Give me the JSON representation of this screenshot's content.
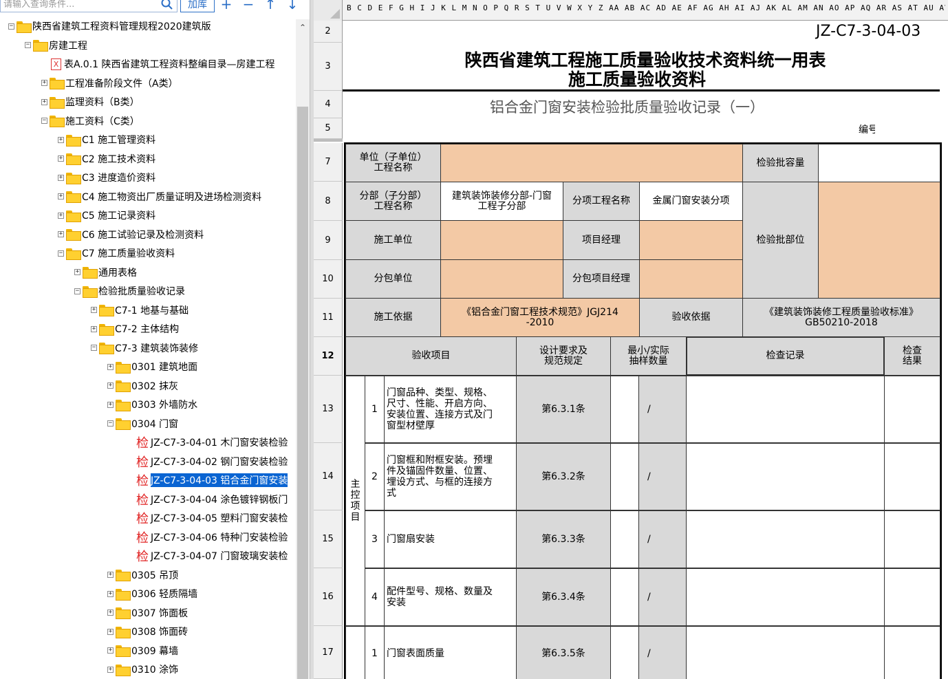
{
  "search": {
    "placeholder": "请输入查询条件...",
    "add_lib_label": "加库"
  },
  "toolbar": {
    "plus": "+",
    "minus": "−",
    "up": "↑",
    "down": "↓"
  },
  "tree": [
    {
      "label": "陕西省建筑工程资料管理规程2020建筑版",
      "icon": "folder",
      "expander": "−"
    },
    {
      "label": "房建工程",
      "icon": "folder",
      "expander": "−"
    },
    {
      "label": "表A.0.1 陕西省建筑工程资料整编目录—房建工程",
      "icon": "xls",
      "expander": ""
    },
    {
      "label": "工程准备阶段文件（A类）",
      "icon": "folder",
      "expander": "+"
    },
    {
      "label": "监理资料（B类）",
      "icon": "folder",
      "expander": "+"
    },
    {
      "label": "施工资料（C类）",
      "icon": "folder",
      "expander": "−"
    },
    {
      "label": "C1 施工管理资料",
      "icon": "folder",
      "expander": "+"
    },
    {
      "label": "C2 施工技术资料",
      "icon": "folder",
      "expander": "+"
    },
    {
      "label": "C3 进度造价资料",
      "icon": "folder",
      "expander": "+"
    },
    {
      "label": "C4 施工物资出厂质量证明及进场检测资料",
      "icon": "folder",
      "expander": "+"
    },
    {
      "label": "C5 施工记录资料",
      "icon": "folder",
      "expander": "+"
    },
    {
      "label": "C6 施工试验记录及检测资料",
      "icon": "folder",
      "expander": "+"
    },
    {
      "label": "C7 施工质量验收资料",
      "icon": "folder",
      "expander": "−"
    },
    {
      "label": "通用表格",
      "icon": "folder",
      "expander": "+"
    },
    {
      "label": "检验批质量验收记录",
      "icon": "folder",
      "expander": "−"
    },
    {
      "label": "C7-1  地基与基础",
      "icon": "folder",
      "expander": "+"
    },
    {
      "label": "C7-2  主体结构",
      "icon": "folder",
      "expander": "+"
    },
    {
      "label": "C7-3  建筑装饰装修",
      "icon": "folder",
      "expander": "−"
    },
    {
      "label": "0301  建筑地面",
      "icon": "folder",
      "expander": "+"
    },
    {
      "label": "0302  抹灰",
      "icon": "folder",
      "expander": "+"
    },
    {
      "label": "0303  外墙防水",
      "icon": "folder",
      "expander": "+"
    },
    {
      "label": "0304  门窗",
      "icon": "folder",
      "expander": "−"
    },
    {
      "label": "JZ-C7-3-04-01  木门窗安装检验",
      "icon": "check",
      "expander": ""
    },
    {
      "label": "JZ-C7-3-04-02  钢门窗安装检验",
      "icon": "check",
      "expander": ""
    },
    {
      "label": "JZ-C7-3-04-03  铝合金门窗安装",
      "icon": "check",
      "expander": "",
      "selected": true
    },
    {
      "label": "JZ-C7-3-04-04  涂色镀锌钢板门",
      "icon": "check",
      "expander": ""
    },
    {
      "label": "JZ-C7-3-04-05  塑料门窗安装检",
      "icon": "check",
      "expander": ""
    },
    {
      "label": "JZ-C7-3-04-06  特种门安装检验",
      "icon": "check",
      "expander": ""
    },
    {
      "label": "JZ-C7-3-04-07  门窗玻璃安装检",
      "icon": "check",
      "expander": ""
    },
    {
      "label": "0305  吊顶",
      "icon": "folder",
      "expander": "+"
    },
    {
      "label": "0306  轻质隔墙",
      "icon": "folder",
      "expander": "+"
    },
    {
      "label": "0307  饰面板",
      "icon": "folder",
      "expander": "+"
    },
    {
      "label": "0308  饰面砖",
      "icon": "folder",
      "expander": "+"
    },
    {
      "label": "0309  幕墙",
      "icon": "folder",
      "expander": "+"
    },
    {
      "label": "0310  涂饰",
      "icon": "folder",
      "expander": "+"
    }
  ],
  "tree_check_glyph": "检",
  "sheet": {
    "column_letters": "B C D E F G H I J K L M N O P Q R S T U V W X Y Z AA AB AC AD AE AF AG AH AI AJ AK AL AM AN AO AP AQ AR AS AT AU AV AW AX AY AZ BA BB BC BD BE BF BG",
    "row_numbers": [
      "2",
      "3",
      "4",
      "5",
      "7",
      "8",
      "9",
      "10",
      "11",
      "12",
      "13",
      "14",
      "15",
      "16",
      "17"
    ],
    "code": "JZ-C7-3-04-03",
    "title1": "陕西省建筑工程施工质量验收技术资料统一用表",
    "title2": "施工质量验收资料",
    "subtitle": "铝合金门窗安装检验批质量验收记录（一）",
    "number_label": "编号:",
    "unit_label": "单位（子单位）\n工程名称",
    "capacity_label": "检验批容量",
    "division_label": "分部（子分部）\n工程名称",
    "division_value": "建筑装饰装修分部-门窗\n工程子分部",
    "subitem_label": "分项工程名称",
    "subitem_value": "金属门窗安装分项",
    "location_label": "检验批部位",
    "constructor_label": "施工单位",
    "pm_label": "项目经理",
    "subcontractor_label": "分包单位",
    "sub_pm_label": "分包项目经理",
    "basis_label": "施工依据",
    "basis_value": "《铝合金门窗工程技术规范》JGJ214\n-2010",
    "acceptance_basis_label": "验收依据",
    "acceptance_basis_value": "《建筑装饰装修工程质量验收标准》\nGB50210-2018",
    "hdr_item": "验收项目",
    "hdr_design": "设计要求及\n规范规定",
    "hdr_sample": "最小/实际\n抽样数量",
    "hdr_record": "检查记录",
    "hdr_result": "检查\n结果",
    "main_control": "主\n控\n项\n目",
    "rows": [
      {
        "no": "1",
        "item": "门窗品种、类型、规格、\n尺寸、性能、开启方向、\n安装位置、连接方式及门\n窗型材壁厚",
        "clause": "第6.3.1条",
        "slash": "/"
      },
      {
        "no": "2",
        "item": "门窗框和附框安装。预埋\n件及锚固件数量、位置、\n埋设方式、与框的连接方\n式",
        "clause": "第6.3.2条",
        "slash": "/"
      },
      {
        "no": "3",
        "item": "门窗扇安装",
        "clause": "第6.3.3条",
        "slash": "/"
      },
      {
        "no": "4",
        "item": "配件型号、规格、数量及\n安装",
        "clause": "第6.3.4条",
        "slash": "/"
      },
      {
        "no": "1",
        "item": "门窗表面质量",
        "clause": "第6.3.5条",
        "slash": "/"
      }
    ]
  }
}
